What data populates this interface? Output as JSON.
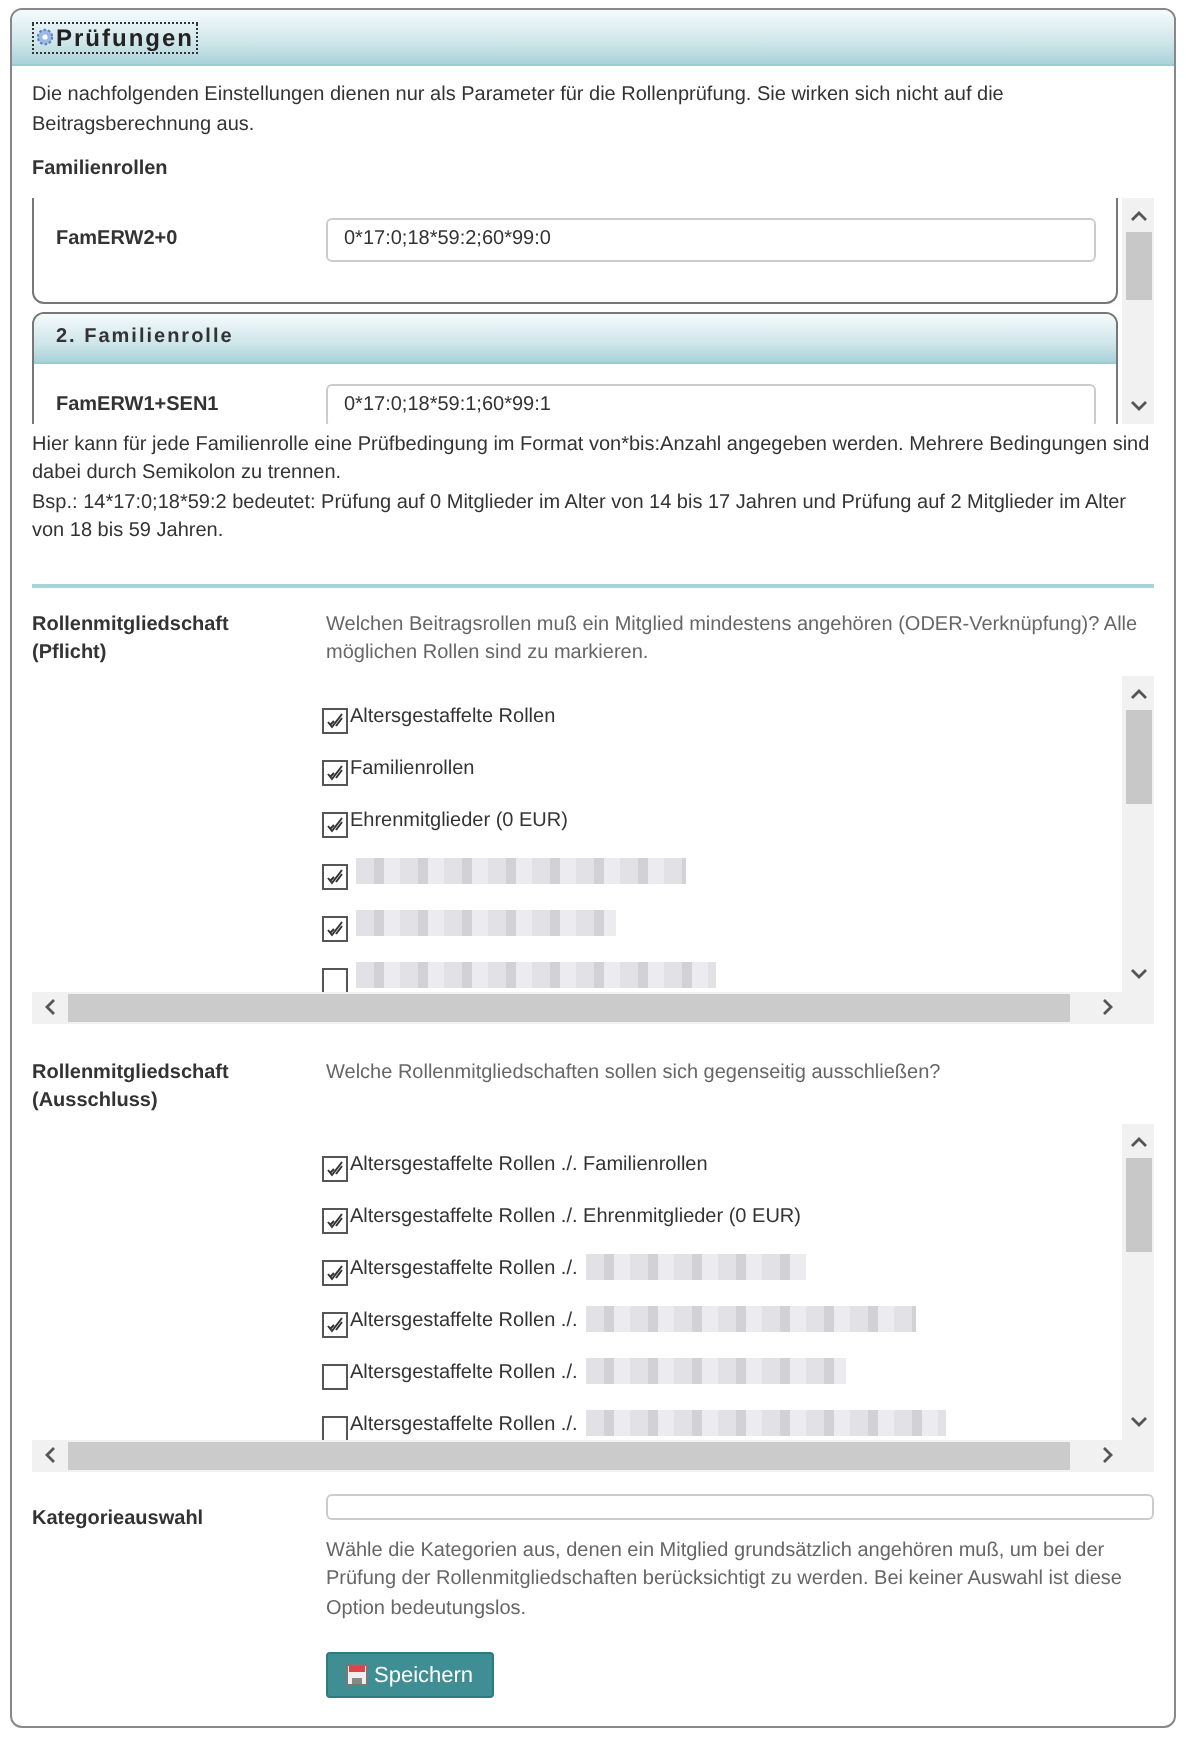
{
  "panel": {
    "title": "Prüfungen",
    "intro": "Die nachfolgenden Einstellungen dienen nur als Parameter für die Rollenprüfung. Sie wirken sich nicht auf die Beitragsberechnung aus."
  },
  "family_roles": {
    "label": "Familienrollen",
    "cards": [
      {
        "field_label": "FamERW2+0",
        "value": "0*17:0;18*59:2;60*99:0"
      },
      {
        "title": "2. Familienrolle",
        "field_label": "FamERW1+SEN1",
        "value": "0*17:0;18*59:1;60*99:1"
      }
    ],
    "help": [
      "Hier kann für jede Familienrolle eine Prüfbedingung im Format von*bis:Anzahl angegeben werden. Mehrere Bedingungen sind dabei durch Semikolon zu trennen.",
      "Bsp.: 14*17:0;18*59:2 bedeutet: Prüfung auf 0 Mitglieder im Alter von 14 bis 17 Jahren und Prüfung auf 2 Mitglieder im Alter von 18 bis 59 Jahren."
    ]
  },
  "required_membership": {
    "label": "Rollenmitgliedschaft (Pflicht)",
    "description": "Welchen Beitragsrollen muß ein Mitglied mindestens angehören (ODER-Verknüpfung)? Alle möglichen Rollen sind zu markieren.",
    "options": [
      {
        "label": "Altersgestaffelte Rollen",
        "checked": true,
        "redacted": false
      },
      {
        "label": "Familienrollen",
        "checked": true,
        "redacted": false
      },
      {
        "label": "Ehrenmitglieder (0 EUR)",
        "checked": true,
        "redacted": false
      },
      {
        "checked": true,
        "redacted": true
      },
      {
        "checked": true,
        "redacted": true
      },
      {
        "checked": false,
        "redacted": true
      }
    ]
  },
  "exclusive_membership": {
    "label": "Rollenmitgliedschaft (Ausschluss)",
    "description": "Welche Rollenmitgliedschaften sollen sich gegenseitig ausschließen?",
    "options": [
      {
        "label": "Altersgestaffelte Rollen ./. Familienrollen",
        "checked": true,
        "redacted": false
      },
      {
        "label": "Altersgestaffelte Rollen ./. Ehrenmitglieder (0 EUR)",
        "checked": true,
        "redacted": false
      },
      {
        "label": "Altersgestaffelte Rollen ./.",
        "checked": true,
        "redacted": true
      },
      {
        "label": "Altersgestaffelte Rollen ./.",
        "checked": true,
        "redacted": true
      },
      {
        "label": "Altersgestaffelte Rollen ./.",
        "checked": false,
        "redacted": true
      },
      {
        "label": "Altersgestaffelte Rollen ./.",
        "checked": false,
        "redacted": true
      }
    ]
  },
  "category": {
    "label": "Kategorieauswahl",
    "description": "Wähle die Kategorien aus, denen ein Mitglied grundsätzlich angehören muß, um bei der Prüfung der Rollenmitgliedschaften berücksichtigt zu werden. Bei keiner Auswahl ist diese Option bedeutungslos."
  },
  "save_button": "Speichern"
}
